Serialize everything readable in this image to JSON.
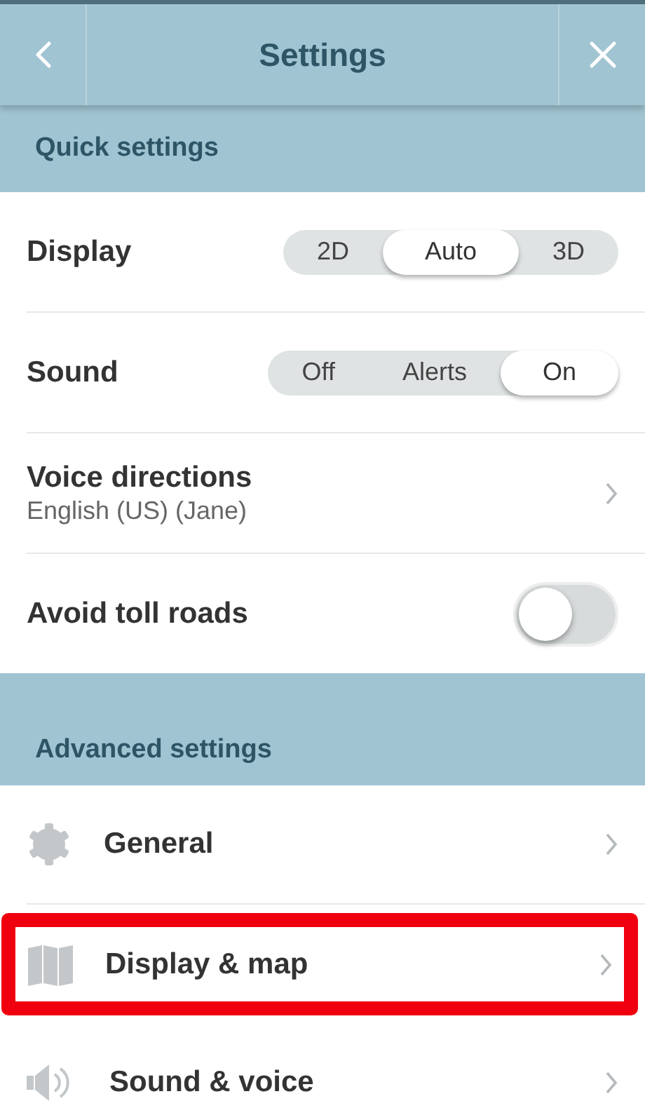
{
  "header": {
    "title": "Settings"
  },
  "quick_settings": {
    "title": "Quick settings",
    "rows": [
      {
        "kind": "segmented",
        "label": "Display",
        "options": [
          {
            "label": "2D",
            "selected": false
          },
          {
            "label": "Auto",
            "selected": true
          },
          {
            "label": "3D",
            "selected": false
          }
        ]
      },
      {
        "kind": "segmented",
        "label": "Sound",
        "options": [
          {
            "label": "Off",
            "selected": false
          },
          {
            "label": "Alerts",
            "selected": false
          },
          {
            "label": "On",
            "selected": true
          }
        ]
      },
      {
        "kind": "link",
        "label": "Voice directions",
        "value": "English (US) (Jane)"
      },
      {
        "kind": "toggle",
        "label": "Avoid toll roads",
        "on": false
      }
    ]
  },
  "advanced_settings": {
    "title": "Advanced settings",
    "items": [
      {
        "label": "General",
        "highlighted": false
      },
      {
        "label": "Display & map",
        "highlighted": true
      },
      {
        "label": "Sound & voice",
        "highlighted": false
      }
    ]
  }
}
